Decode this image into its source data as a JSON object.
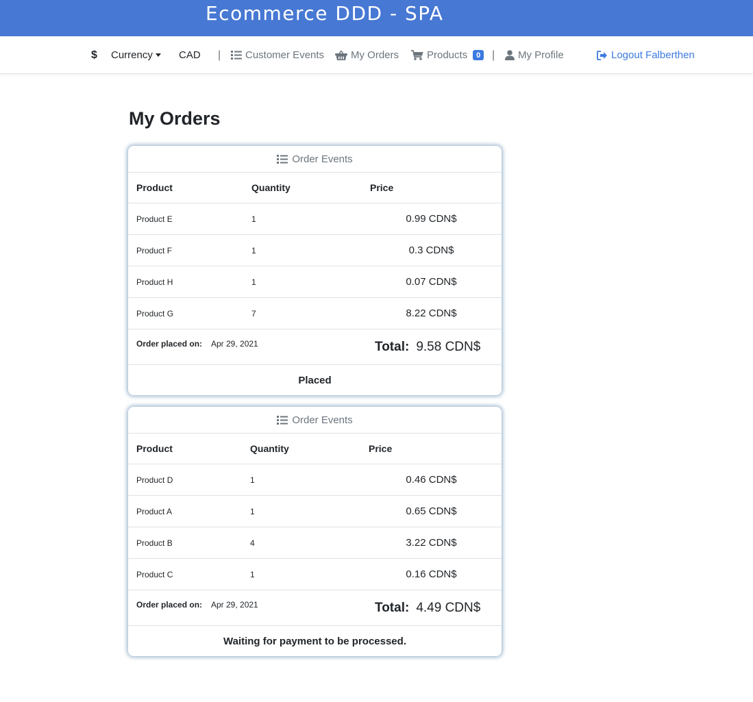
{
  "app": {
    "title": "Ecommerce DDD - SPA"
  },
  "nav": {
    "dollar_symbol": "$",
    "currency_label": "Currency",
    "selected_currency": "CAD",
    "separator": "|",
    "customer_events": "Customer Events",
    "my_orders": "My Orders",
    "products": "Products",
    "products_badge": "0",
    "my_profile": "My Profile",
    "logout": "Logout Falberthen"
  },
  "colors": {
    "banner": "#4778d3",
    "accent": "#3c7ae0",
    "muted": "#6c757d"
  },
  "page": {
    "heading": "My Orders"
  },
  "table_headers": {
    "product": "Product",
    "quantity": "Quantity",
    "price": "Price"
  },
  "orders": [
    {
      "header": "Order Events",
      "items": [
        {
          "product": "Product E",
          "quantity": "1",
          "price": "0.99 CDN$"
        },
        {
          "product": "Product F",
          "quantity": "1",
          "price": "0.3 CDN$"
        },
        {
          "product": "Product H",
          "quantity": "1",
          "price": "0.07 CDN$"
        },
        {
          "product": "Product G",
          "quantity": "7",
          "price": "8.22 CDN$"
        }
      ],
      "placed_label": "Order placed on:",
      "placed_date": "Apr 29, 2021",
      "total_label": "Total:",
      "total_value": "9.58 CDN$",
      "status": "Placed"
    },
    {
      "header": "Order Events",
      "items": [
        {
          "product": "Product D",
          "quantity": "1",
          "price": "0.46 CDN$"
        },
        {
          "product": "Product A",
          "quantity": "1",
          "price": "0.65 CDN$"
        },
        {
          "product": "Product B",
          "quantity": "4",
          "price": "3.22 CDN$"
        },
        {
          "product": "Product C",
          "quantity": "1",
          "price": "0.16 CDN$"
        }
      ],
      "placed_label": "Order placed on:",
      "placed_date": "Apr 29, 2021",
      "total_label": "Total:",
      "total_value": "4.49 CDN$",
      "status": "Waiting for payment to be processed."
    }
  ],
  "icons": {
    "list": "list-icon",
    "basket": "basket-icon",
    "cart": "cart-icon",
    "user": "user-icon",
    "logout": "logout-icon"
  }
}
